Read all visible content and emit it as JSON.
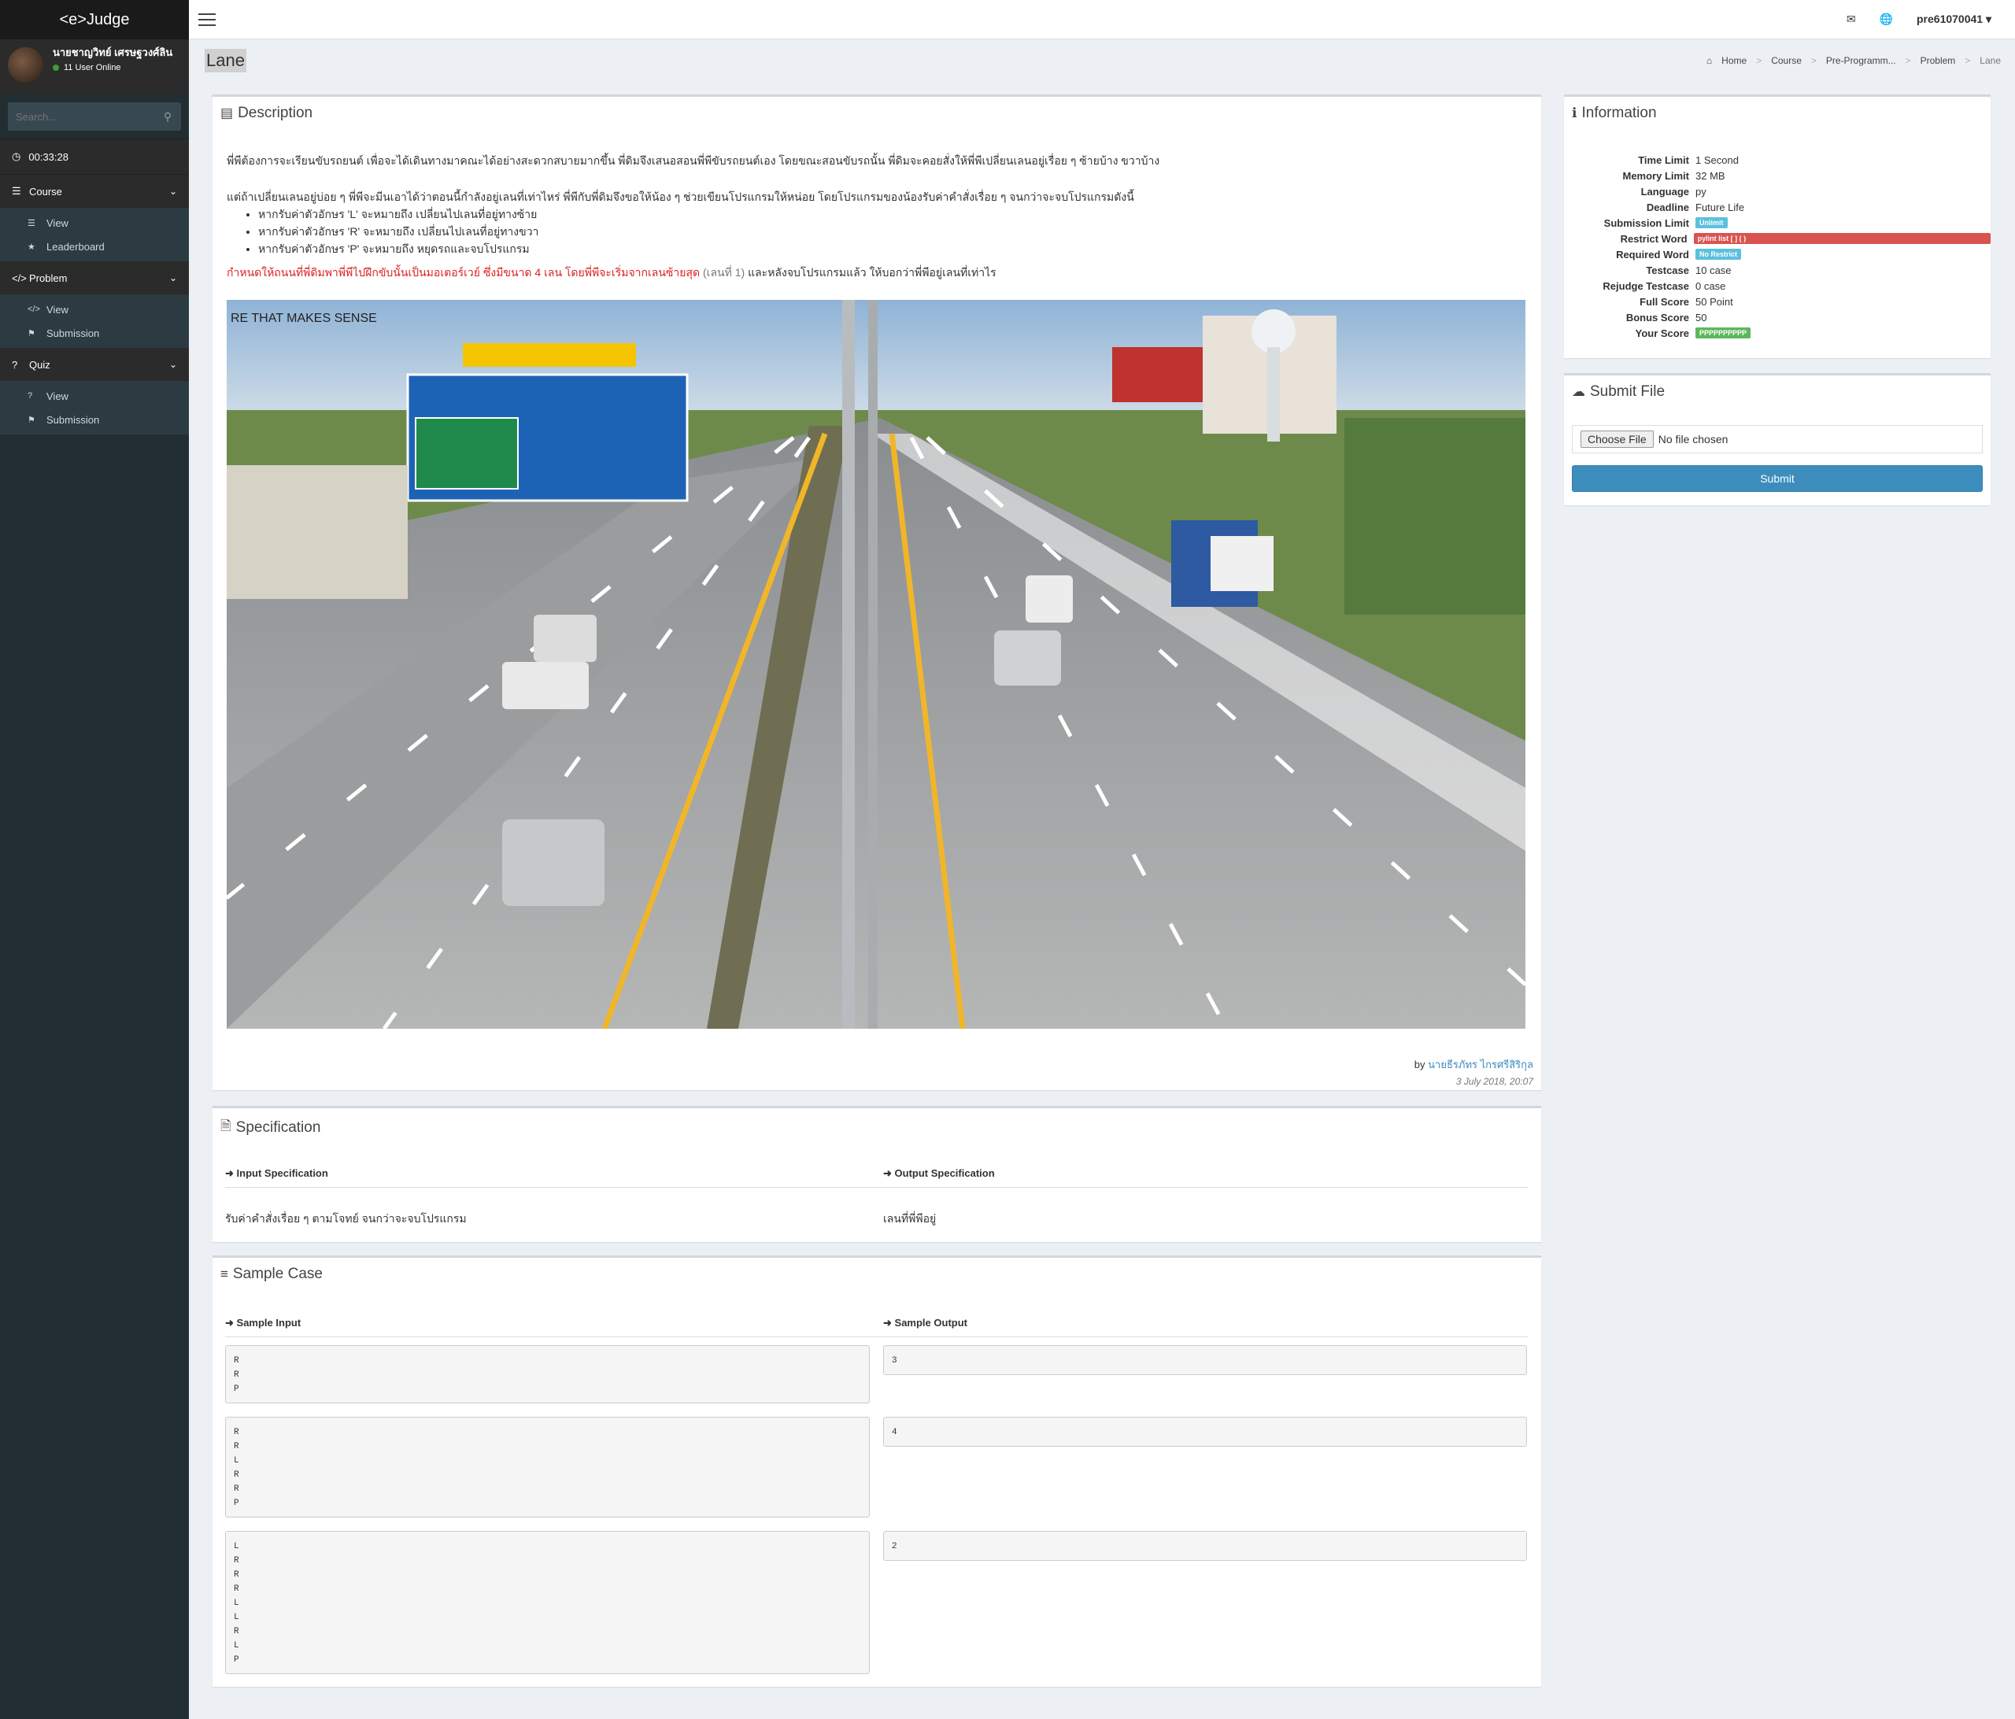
{
  "app": {
    "logo": "<e>Judge"
  },
  "user": {
    "name": "นายชาญวิทย์ เศรษฐวงศ์ลิน",
    "online": "11 User Online",
    "username": "pre61070041"
  },
  "search": {
    "placeholder": "Search..."
  },
  "timer": "00:33:28",
  "menu": [
    {
      "label": "Course",
      "items": [
        "View",
        "Leaderboard"
      ]
    },
    {
      "label": "Problem",
      "items": [
        "View",
        "Submission"
      ]
    },
    {
      "label": "Quiz",
      "items": [
        "View",
        "Submission"
      ]
    }
  ],
  "page": {
    "title": "Lane"
  },
  "breadcrumb": [
    "Home",
    "Course",
    "Pre-Programm...",
    "Problem",
    "Lane"
  ],
  "description": {
    "title": "Description",
    "p1": "พี่พีต้องการจะเรียนขับรถยนต์ เพื่อจะได้เดินทางมาคณะได้อย่างสะดวกสบายมากขึ้น พี่ดิมจึงเสนอสอนพี่พีขับรถยนต์เอง โดยขณะสอนขับรถนั้น พี่ดิมจะคอยสั่งให้พี่พีเปลี่ยนเลนอยู่เรื่อย ๆ ซ้ายบ้าง ขวาบ้าง",
    "p2": "แต่ถ้าเปลี่ยนเลนอยู่บ่อย ๆ พี่พีจะมีนเอาได้ว่าตอนนี้กำลังอยู่เลนที่เท่าไหร่ พี่พีกับพี่ดิมจึงขอให้น้อง ๆ ช่วยเขียนโปรแกรมให้หน่อย โดยโปรแกรมของน้องรับค่าคำสั่งเรื่อย ๆ จนกว่าจะจบโปรแกรมดังนี้",
    "rules": [
      "หากรับค่าตัวอักษร 'L' จะหมายถึง เปลี่ยนไปเลนที่อยู่ทางซ้าย",
      "หากรับค่าตัวอักษร 'R' จะหมายถึง เปลี่ยนไปเลนที่อยู่ทางขวา",
      "หากรับค่าตัวอักษร 'P' จะหมายถึง หยุดรถและจบโปรแกรม"
    ],
    "p3_red": "กำหนดให้ถนนที่พี่ดิมพาพี่พีไปฝึกขับนั้นเป็นมอเตอร์เวย์ ซึ่งมีขนาด 4 เลน โดยพี่พีจะเริ่มจากเลนซ้ายสุด",
    "p3_muted": "(เลนที่ 1)",
    "p3_rest": "และหลังจบโปรแกรมแล้ว ให้บอกว่าพี่พีอยู่เลนที่เท่าไร",
    "image_sign_text": "RE THAT MAKES SENSE",
    "by_label": "by",
    "author": "นายธีรภัทร ไกรศรีสิริกุล",
    "date": "3 July 2018, 20:07"
  },
  "specification": {
    "title": "Specification",
    "input_label": "Input Specification",
    "output_label": "Output Specification",
    "input_text": "รับค่าคำสั่งเรื่อย ๆ ตามโจทย์ จนกว่าจะจบโปรแกรม",
    "output_text": "เลนที่พี่พีอยู่"
  },
  "samples": {
    "title": "Sample Case",
    "input_label": "Sample Input",
    "output_label": "Sample Output",
    "cases": [
      {
        "input": "R\nR\nP",
        "output": "3"
      },
      {
        "input": "R\nR\nL\nR\nR\nP",
        "output": "4"
      },
      {
        "input": "L\nR\nR\nR\nL\nL\nR\nL\nP",
        "output": "2"
      }
    ]
  },
  "information": {
    "title": "Information",
    "rows": [
      {
        "k": "Time Limit",
        "v": "1 Second"
      },
      {
        "k": "Memory Limit",
        "v": "32 MB"
      },
      {
        "k": "Language",
        "v": "py"
      },
      {
        "k": "Deadline",
        "v": "Future Life"
      },
      {
        "k": "Submission Limit",
        "badge": "Unlimit",
        "color": "#5bc0de"
      },
      {
        "k": "Restrict Word",
        "badge": "pylint list [ ] ( )",
        "color": "#d9534f"
      },
      {
        "k": "Required Word",
        "badge": "No Restrict",
        "color": "#5bc0de"
      },
      {
        "k": "Testcase",
        "v": "10 case"
      },
      {
        "k": "Rejudge Testcase",
        "v": "0 case"
      },
      {
        "k": "Full Score",
        "v": "50 Point"
      },
      {
        "k": "Bonus Score",
        "v": "50"
      },
      {
        "k": "Your Score",
        "badge": "PPPPPPPPPP",
        "color": "#5cb85c"
      }
    ]
  },
  "submit": {
    "title": "Submit File",
    "choose": "Choose File",
    "no_file": "No file chosen",
    "button": "Submit"
  }
}
